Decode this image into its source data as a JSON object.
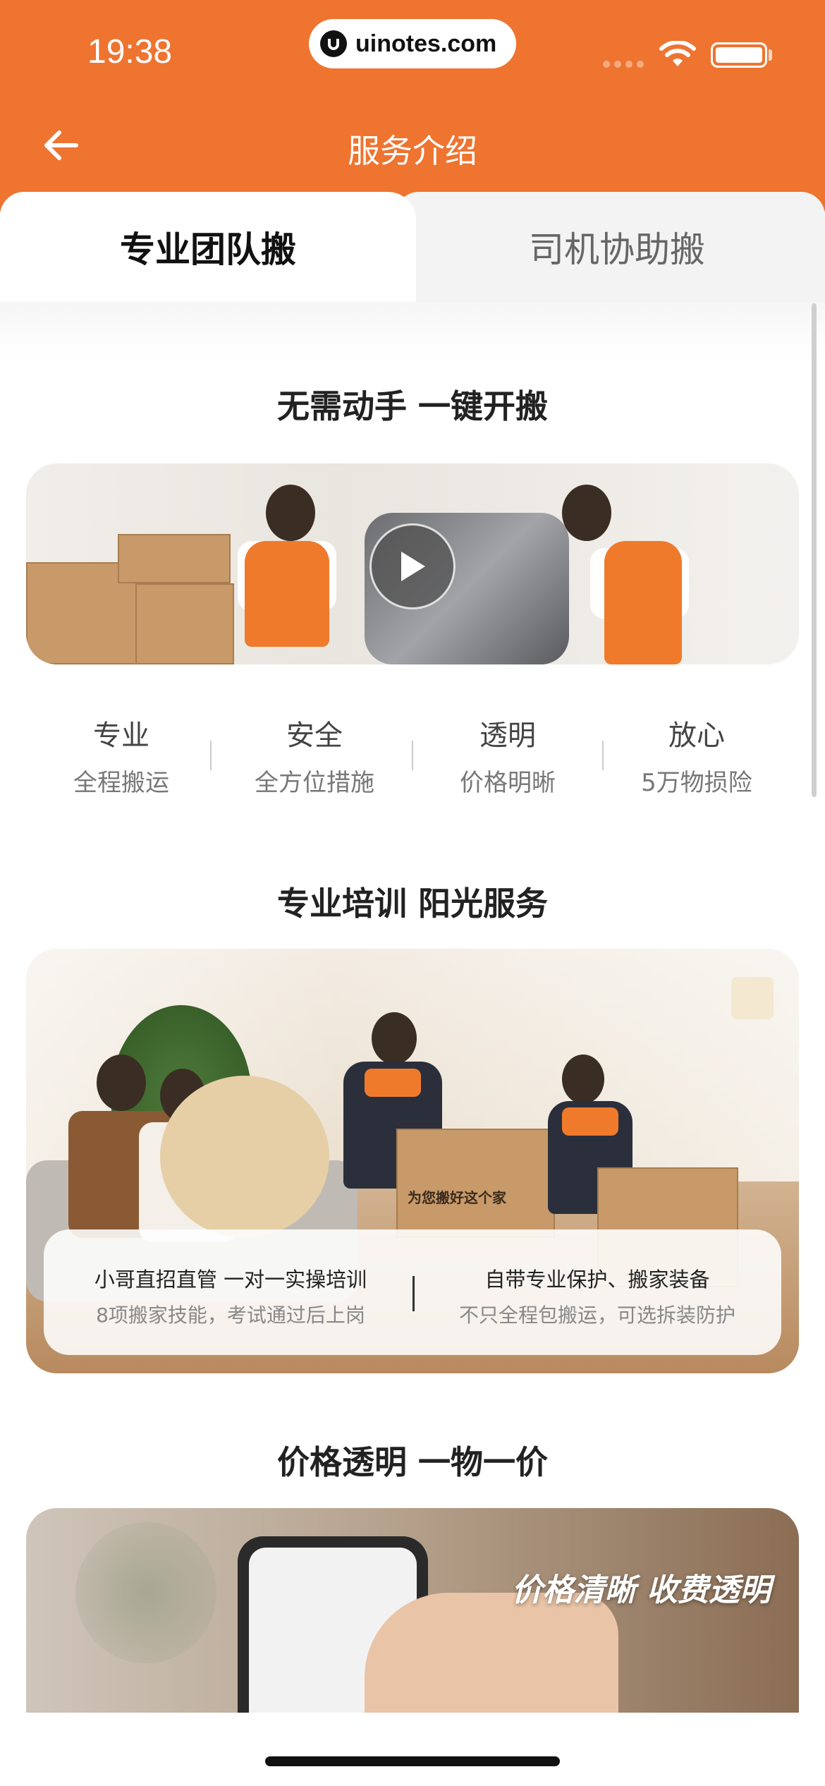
{
  "status_bar": {
    "time": "19:38",
    "url": "uinotes.com"
  },
  "header": {
    "title": "服务介绍",
    "back_icon": "arrow-left-icon"
  },
  "tabs": [
    {
      "label": "专业团队搬",
      "active": true
    },
    {
      "label": "司机协助搬",
      "active": false
    }
  ],
  "sections": {
    "s1": {
      "title": "无需动手  一键开搬"
    },
    "s2": {
      "title": "专业培训  阳光服务"
    },
    "s3": {
      "title": "价格透明  一物一价"
    }
  },
  "features": [
    {
      "title": "专业",
      "desc": "全程搬运"
    },
    {
      "title": "安全",
      "desc": "全方位措施"
    },
    {
      "title": "透明",
      "desc": "价格明晰"
    },
    {
      "title": "放心",
      "desc": "5万物损险"
    }
  ],
  "training_card": {
    "left": {
      "title": "小哥直招直管 一对一实操培训",
      "desc": "8项搬家技能，考试通过后上岗"
    },
    "right": {
      "title": "自带专业保护、搬家装备",
      "desc": "不只全程包搬运，可选拆装防护"
    }
  },
  "box_print": "为您搬好这个家",
  "price_banner_text": "价格清晰 收费透明",
  "colors": {
    "brand_orange": "#ee7430",
    "tab_inactive_bg": "#f3f3f3"
  }
}
